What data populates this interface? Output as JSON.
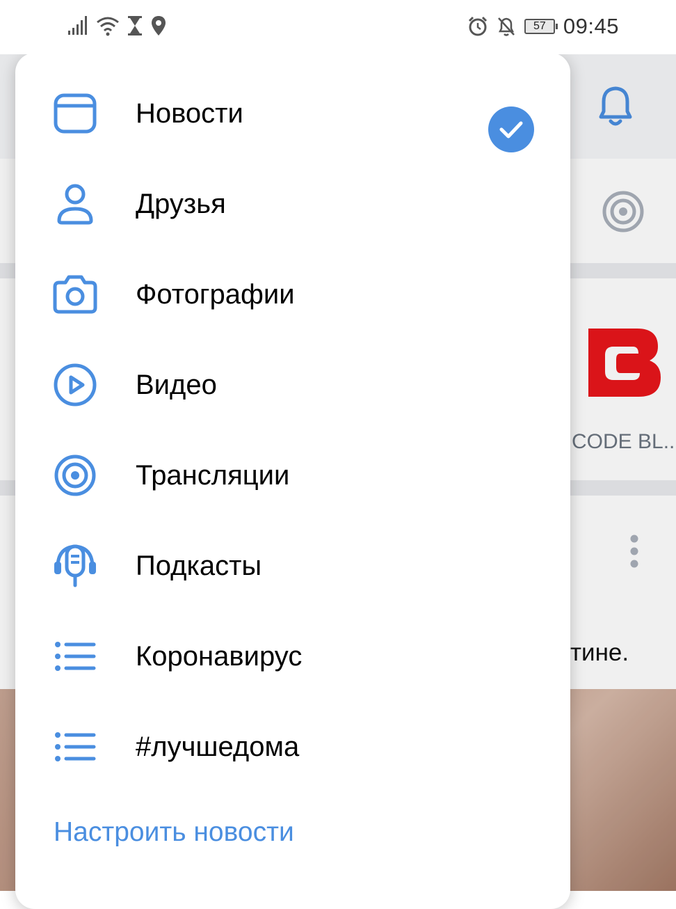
{
  "status_bar": {
    "time": "09:45",
    "battery": "57"
  },
  "menu": {
    "items": [
      {
        "label": "Новости",
        "icon": "window-icon",
        "selected": true
      },
      {
        "label": "Друзья",
        "icon": "user-icon"
      },
      {
        "label": "Фотографии",
        "icon": "camera-icon"
      },
      {
        "label": "Видео",
        "icon": "play-circle-icon"
      },
      {
        "label": "Трансляции",
        "icon": "broadcast-icon"
      },
      {
        "label": "Подкасты",
        "icon": "podcast-icon"
      },
      {
        "label": "Коронавирус",
        "icon": "list-icon"
      },
      {
        "label": "#лучшедома",
        "icon": "list-icon"
      }
    ],
    "configure_link": "Настроить новости"
  },
  "background": {
    "community_name": "CODE BL...",
    "post_text_fragment": "тине."
  },
  "colors": {
    "accent": "#4a8ee0",
    "logo_red": "#e8161b"
  }
}
